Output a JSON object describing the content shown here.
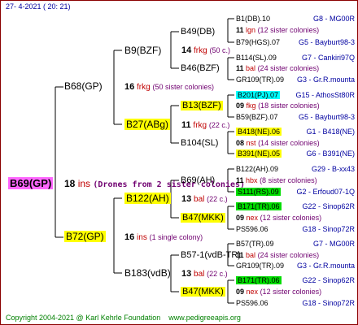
{
  "header": {
    "date": "27-  4-2021 ( 20: 21)"
  },
  "colors": {
    "yellow_hl": "#ffff00",
    "pink_hl": "#ff66ff",
    "cyan_hl": "#00ffff",
    "green_hl": "#00dd00",
    "frame": "#8a0000"
  },
  "root": {
    "name": "B69(GP)",
    "n": "18",
    "mate": "ins",
    "note": "(Drones from 2 sister colonies)"
  },
  "gen1": [
    {
      "name": "B68(GP)",
      "n": "16",
      "mate": "frkg",
      "note": "(50 sister colonies)"
    },
    {
      "name": "B72(GP)",
      "n": "16",
      "mate": "ins",
      "note": "(1 single colony)"
    }
  ],
  "gen2": [
    {
      "name": "B9(BZF)",
      "n": "14",
      "mate": "frkg",
      "note": "(50 c.)"
    },
    {
      "name": "B27(ABg)",
      "n": "11",
      "mate": "frkg",
      "note": "(22 c.)"
    },
    {
      "name": "B122(AH)",
      "n": "13",
      "mate": "bal",
      "note": "(22 c.)"
    },
    {
      "name": "B183(vdB)",
      "n": "13",
      "mate": "bal",
      "note": "(22 c.)"
    }
  ],
  "gen3": [
    {
      "name": "B49(DB)"
    },
    {
      "name": "B46(BZF)"
    },
    {
      "name": "B13(BZF)",
      "n": "11",
      "mate": "frkg",
      "note": "(22 c.)"
    },
    {
      "name": "B104(SL)",
      "n": "08",
      "mate": "nst",
      "note": "(14 sister colonies)"
    },
    {
      "name": "B69(AH)",
      "n": "11",
      "mate": "hbx",
      "note": "(8 sister colonies)"
    },
    {
      "name": "B47(MKK)",
      "n": "09",
      "mate": "nex",
      "note": "(12 sister colonies)"
    },
    {
      "name": "B57-1(vdB-TR)",
      "n": "11",
      "mate": "bal",
      "note": "(24 sister colonies)"
    },
    {
      "name": "B47(MKK)",
      "n": "09",
      "mate": "nex",
      "note": "(12 sister colonies)"
    }
  ],
  "gen4": [
    {
      "name": "B1(DB).10",
      "num": "G8",
      "loc": "MG00R"
    },
    {
      "name": "B79(HGS).07",
      "num": "G5",
      "loc": "Bayburt98-3"
    },
    {
      "name": "B114(SL).09",
      "num": "G7",
      "loc": "Cankiri97Q"
    },
    {
      "name": "GR109(TR).09",
      "num": "G3",
      "loc": "Gr.R.mounta"
    },
    {
      "name": "B201(PJ).07",
      "num": "G15",
      "loc": "AthosSt80R"
    },
    {
      "name": "B59(BZF).07",
      "num": "G5",
      "loc": "Bayburt98-3"
    },
    {
      "name": "B418(NE).06",
      "num": "G1",
      "loc": "B418(NE)"
    },
    {
      "name": "B391(NE).05",
      "num": "G6",
      "loc": "B391(NE)"
    },
    {
      "name": "B122(AH).09",
      "num": "G29",
      "loc": "B-xx43"
    },
    {
      "name": "S111(RS).09",
      "num": "G2",
      "loc": "Erfoud07-1Q"
    },
    {
      "name": "B171(TR).06",
      "num": "G22",
      "loc": "Sinop62R"
    },
    {
      "name": "PS596.06",
      "num": "G18",
      "loc": "Sinop72R"
    },
    {
      "name": "B57(TR).09",
      "num": "G7",
      "loc": "MG00R"
    },
    {
      "name": "GR109(TR).09",
      "num": "G3",
      "loc": "Gr.R.mounta"
    },
    {
      "name": "B171(TR).06",
      "num": "G22",
      "loc": "Sinop62R"
    },
    {
      "name": "PS596.06",
      "num": "G18",
      "loc": "Sinop72R"
    }
  ],
  "gen4_mates": [
    {
      "n": "11",
      "mate": "lgn",
      "note": "(12 sister colonies)"
    },
    {
      "n": "11",
      "mate": "bal",
      "note": "(24 sister colonies)"
    },
    {
      "n": "09",
      "mate": "fkg",
      "note": "(18 sister colonies)"
    },
    {
      "n": "08",
      "mate": "nst",
      "note": "(14 sister colonies)"
    },
    {
      "n": "11",
      "mate": "hbx",
      "note": "(8 sister colonies)"
    },
    {
      "n": "09",
      "mate": "nex",
      "note": "(12 sister colonies)"
    },
    {
      "n": "11",
      "mate": "bal",
      "note": "(24 sister colonies)"
    },
    {
      "n": "09",
      "mate": "nex",
      "note": "(12 sister colonies)"
    }
  ],
  "footer": {
    "copyright": "Copyright 2004-2021 @ Karl Kehrle Foundation",
    "site": "www.pedigreeapis.org"
  }
}
